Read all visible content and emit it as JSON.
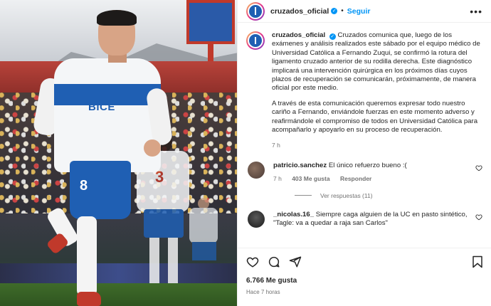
{
  "header": {
    "username": "cruzados_oficial",
    "separator": "•",
    "follow_label": "Seguir",
    "more_label": "•••"
  },
  "post": {
    "username": "cruzados_oficial",
    "caption_p1": "Cruzados comunica que, luego de los exámenes y análisis realizados este sábado por el equipo médico de Universidad Católica a Fernando Zuqui, se confirmó la rotura del ligamento cruzado anterior de su rodilla derecha. Este diagnóstico implicará una intervención quirúrgica en los próximos días cuyos plazos de recuperación se comunicarán, próximamente, de manera oficial por este medio.",
    "caption_p2": "A través de esta comunicación queremos expresar todo nuestro cariño a Fernando, enviándole fuerzas en este momento adverso y reafirmándole el compromiso de todos en Universidad Católica para acompañarlo y apoyarlo en su proceso de recuperación.",
    "time": "7 h"
  },
  "comments": [
    {
      "username": "patricio.sanchez",
      "text": "El único refuerzo bueno :(",
      "time": "7 h",
      "likes": "403 Me gusta",
      "reply_label": "Responder",
      "view_replies": "Ver respuestas (11)"
    },
    {
      "username": "_nicolas.16_",
      "text": "Siempre caga alguien de la UC en pasto sintético, \"Tagle: va a quedar a raja san Carlos\""
    }
  ],
  "footer": {
    "likes": "6.766 Me gusta",
    "ago": "Hace 7 horas"
  },
  "photo": {
    "jersey_sponsor": "BICE",
    "player_number": "8",
    "back_player_number": "3"
  },
  "colors": {
    "accent": "#0095f6",
    "club_blue": "#1f5fb3",
    "club_red": "#c0392b"
  }
}
